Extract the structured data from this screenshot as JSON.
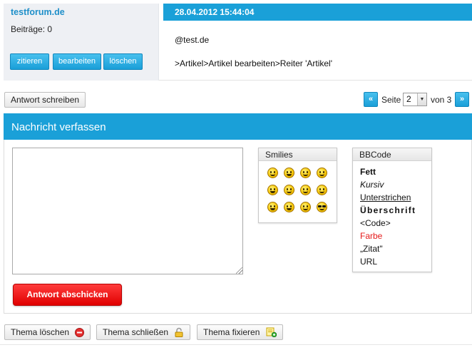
{
  "post": {
    "author": "testforum.de",
    "posts_count": "Beiträge: 0",
    "buttons": [
      "zitieren",
      "bearbeiten",
      "löschen"
    ],
    "date": "28.04.2012 15:44:04",
    "line1": "@test.de",
    "line2": ">Artikel>Artikel bearbeiten>Reiter 'Artikel'"
  },
  "reply_button": "Antwort schreiben",
  "pagination": {
    "prev": "«",
    "label": "Seite",
    "current": "2",
    "of_label": "von 3",
    "next": "»"
  },
  "compose": {
    "title": "Nachricht verfassen",
    "message_value": "",
    "submit": "Antwort abschicken"
  },
  "smilies": {
    "title": "Smilies",
    "icons": [
      "smile-icon",
      "grin-icon",
      "wink-icon",
      "sad-icon",
      "laugh-icon",
      "happy-icon",
      "confused-icon",
      "tongue-icon",
      "big-grin-icon",
      "teeth-icon",
      "rolleyes-icon",
      "cool-icon"
    ]
  },
  "bbcode": {
    "title": "BBCode",
    "items": [
      "Fett",
      "Kursiv",
      "Unterstrichen",
      "Überschrift",
      "<Code>",
      "Farbe",
      "„Zitat\"",
      "URL"
    ]
  },
  "thread_actions": {
    "delete": "Thema löschen",
    "close": "Thema schließen",
    "pin": "Thema fixieren"
  },
  "colors": {
    "accent": "#1aa0d8",
    "submit": "#e00000",
    "farbe": "#e51a1a"
  }
}
